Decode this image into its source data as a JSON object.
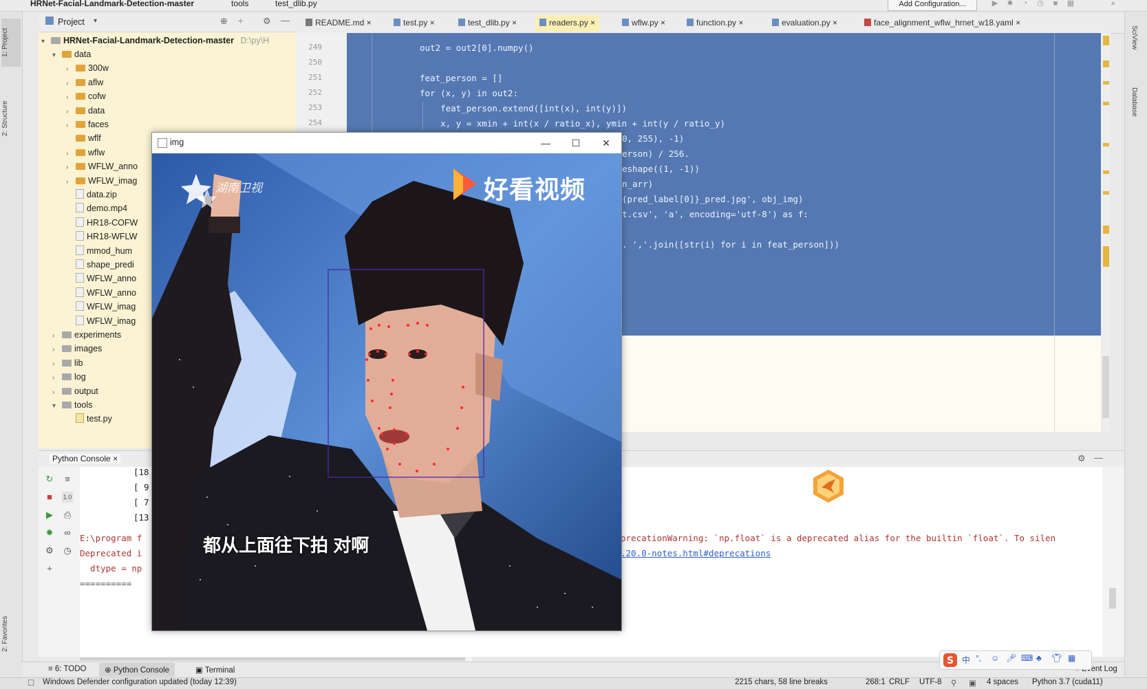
{
  "breadcrumb": [
    "HRNet-Facial-Landmark-Detection-master",
    "tools",
    "test_dlib.py"
  ],
  "run_config_label": "Add Configuration...",
  "left_stripe": {
    "project_label": "1: Project",
    "structure_label": "2: Structure",
    "favorites_label": "2: Favorites"
  },
  "right_stripe": {
    "sciview_label": "SciView",
    "database_label": "Database"
  },
  "project_panel": {
    "title": "Project",
    "root": "HRNet-Facial-Landmark-Detection-master",
    "root_path": "D:\\py\\H",
    "items": [
      {
        "label": "data",
        "kind": "folder",
        "level": 1,
        "open": true
      },
      {
        "label": "300w",
        "kind": "folder",
        "level": 2,
        "open": false
      },
      {
        "label": "aflw",
        "kind": "folder",
        "level": 2,
        "open": false
      },
      {
        "label": "cofw",
        "kind": "folder",
        "level": 2,
        "open": false
      },
      {
        "label": "data",
        "kind": "folder",
        "level": 2,
        "open": false
      },
      {
        "label": "faces",
        "kind": "folder",
        "level": 2,
        "open": false
      },
      {
        "label": "wflf",
        "kind": "folder",
        "level": 2,
        "open": null
      },
      {
        "label": "wflw",
        "kind": "folder",
        "level": 2,
        "open": false
      },
      {
        "label": "WFLW_anno",
        "kind": "folder",
        "level": 2,
        "open": false
      },
      {
        "label": "WFLW_imag",
        "kind": "folder",
        "level": 2,
        "open": false
      },
      {
        "label": "data.zip",
        "kind": "file",
        "level": 2
      },
      {
        "label": "demo.mp4",
        "kind": "file",
        "level": 2
      },
      {
        "label": "HR18-COFW",
        "kind": "file",
        "level": 2
      },
      {
        "label": "HR18-WFLW",
        "kind": "file",
        "level": 2
      },
      {
        "label": "mmod_hum",
        "kind": "file",
        "level": 2
      },
      {
        "label": "shape_predi",
        "kind": "file",
        "level": 2
      },
      {
        "label": "WFLW_anno",
        "kind": "file",
        "level": 2
      },
      {
        "label": "WFLW_anno",
        "kind": "file",
        "level": 2
      },
      {
        "label": "WFLW_imag",
        "kind": "file",
        "level": 2
      },
      {
        "label": "WFLW_imag",
        "kind": "file",
        "level": 2
      },
      {
        "label": "experiments",
        "kind": "gfolder",
        "level": 1,
        "open": false
      },
      {
        "label": "images",
        "kind": "gfolder",
        "level": 1,
        "open": false
      },
      {
        "label": "lib",
        "kind": "gfolder",
        "level": 1,
        "open": false
      },
      {
        "label": "log",
        "kind": "gfolder",
        "level": 1,
        "open": false
      },
      {
        "label": "output",
        "kind": "gfolder",
        "level": 1,
        "open": false
      },
      {
        "label": "tools",
        "kind": "gfolder",
        "level": 1,
        "open": true
      },
      {
        "label": "test.py",
        "kind": "pyfile",
        "level": 2
      }
    ]
  },
  "editor_tabs": [
    "README.md",
    "test.py",
    "test_dlib.py",
    "readers.py",
    "wflw.py",
    "function.py",
    "evaluation.py",
    "face_alignment_wflw_hrnet_w18.yaml"
  ],
  "line_numbers": [
    "249",
    "250",
    "251",
    "252",
    "253",
    "254"
  ],
  "code_lines": [
    "out2 = out2[0].numpy()",
    "",
    "feat_person = []",
    "for (x, y) in out2:",
    "    feat_person.extend([int(x), int(y)])",
    "    x, y = xmin + int(x / ratio_x), ymin + int(y / ratio_y)"
  ],
  "code_fragments": [
    "0, 255), -1)",
    "erson) / 256.",
    "eshape((1, -1))",
    "n_arr)",
    "(pred_label[0]}_pred.jpg', obj_img)",
    "t.csv', 'a', encoding='utf-8') as f:",
    ". ','.join([str(i) for i in feat_person]))"
  ],
  "console": {
    "tab_label": "Python Console",
    "left_lines": [
      "[18",
      "[ 9",
      "[ 7",
      "[13"
    ],
    "error_left": "E:\\program f",
    "warn_left": "Deprecated i",
    "dtype_left": "  dtype = np",
    "sep_left": "==========",
    "error_right": "precationWarning: `np.float` is a deprecated alias for the builtin `float`. To silen",
    "link_right": ".20.0-notes.html#deprecations"
  },
  "bottom_tabs": {
    "todo": "6: TODO",
    "python_console": "Python Console",
    "terminal": "Terminal",
    "event_log": "Event Log"
  },
  "status": {
    "left": "Windows Defender configuration updated (today 12:39)",
    "chars": "2215 chars, 58 line breaks",
    "pos": "268:1",
    "line_sep": "CRLF",
    "encoding": "UTF-8",
    "indent": "4 spaces",
    "interpreter": "Python 3.7 (cuda11)"
  },
  "image_window": {
    "title": "img",
    "minimize": "—",
    "maximize": "☐",
    "close": "✕",
    "watermark_left": "湖南卫视",
    "watermark_right": "好看视频",
    "subtitle": "都从上面往下拍 对啊"
  },
  "ime": {
    "cn": "中"
  },
  "colors": {
    "editor_bg": "#5578b2",
    "project_bg": "#fbf3d3",
    "console_error": "#b03535",
    "link": "#2f5fc8"
  }
}
